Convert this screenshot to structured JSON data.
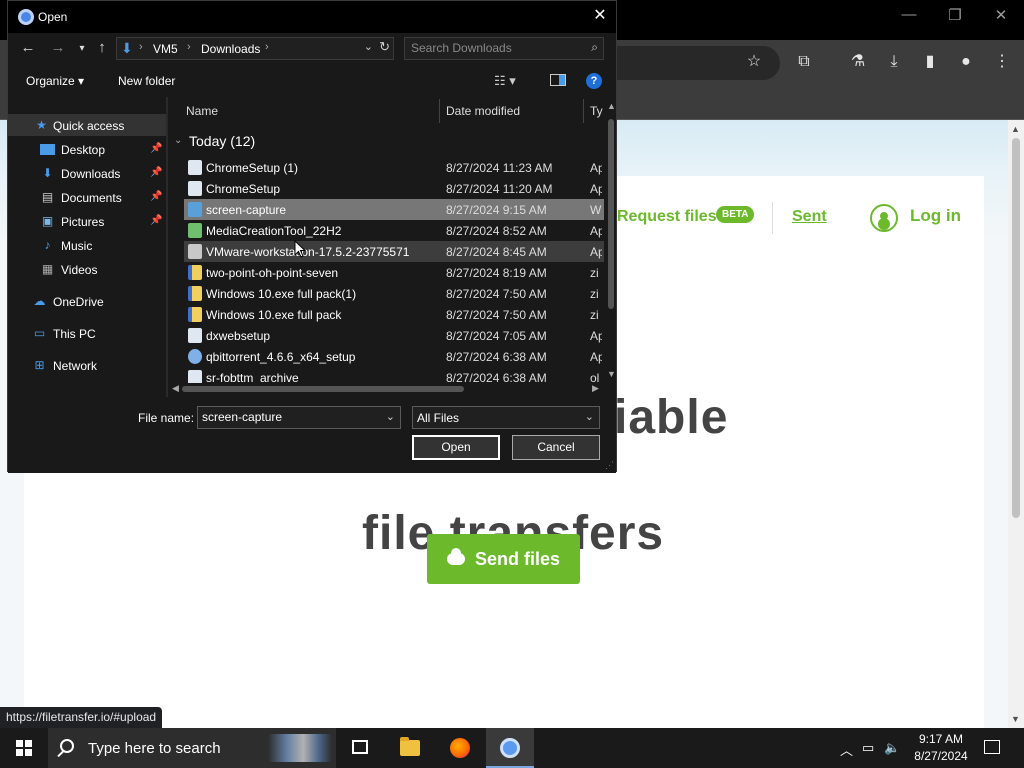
{
  "browser": {
    "nav": {
      "request_files": "Request files",
      "beta": "BETA",
      "sent": "Sent",
      "log_in": "Log in"
    },
    "hero": {
      "line1_visible": "iable",
      "line2_visible": "file transfers"
    },
    "send_button": "Send files",
    "status_url": "https://filetransfer.io/#upload"
  },
  "dialog": {
    "title": "Open",
    "breadcrumb": [
      "VM5",
      "Downloads"
    ],
    "search_placeholder": "Search Downloads",
    "toolbar": {
      "organize": "Organize ▾",
      "new_folder": "New folder",
      "help": "?"
    },
    "nav_pane": {
      "quick_access": "Quick access",
      "items": [
        {
          "label": "Desktop",
          "icon": "desktop-icon",
          "pinned": true
        },
        {
          "label": "Downloads",
          "icon": "downloads-icon",
          "pinned": true
        },
        {
          "label": "Documents",
          "icon": "documents-icon",
          "pinned": true
        },
        {
          "label": "Pictures",
          "icon": "pictures-icon",
          "pinned": true
        },
        {
          "label": "Music",
          "icon": "music-icon",
          "pinned": false
        },
        {
          "label": "Videos",
          "icon": "videos-icon",
          "pinned": false
        }
      ],
      "onedrive": "OneDrive",
      "this_pc": "This PC",
      "network": "Network"
    },
    "columns": {
      "name": "Name",
      "date_modified": "Date modified",
      "type": "Ty"
    },
    "group_header": "Today (12)",
    "files": [
      {
        "name": "ChromeSetup (1)",
        "date": "8/27/2024 11:23 AM",
        "type": "Ap",
        "icon": "installer-icon"
      },
      {
        "name": "ChromeSetup",
        "date": "8/27/2024 11:20 AM",
        "type": "Ap",
        "icon": "installer-icon"
      },
      {
        "name": "screen-capture",
        "date": "8/27/2024 9:15 AM",
        "type": "W",
        "icon": "image-file-icon"
      },
      {
        "name": "MediaCreationTool_22H2",
        "date": "8/27/2024 8:52 AM",
        "type": "Ap",
        "icon": "installer-icon"
      },
      {
        "name": "VMware-workstation-17.5.2-23775571",
        "date": "8/27/2024 8:45 AM",
        "type": "Ap",
        "icon": "installer-icon"
      },
      {
        "name": "two-point-oh-point-seven",
        "date": "8/27/2024 8:19 AM",
        "type": "zi",
        "icon": "zip-icon"
      },
      {
        "name": "Windows 10.exe full pack(1)",
        "date": "8/27/2024 7:50 AM",
        "type": "zi",
        "icon": "zip-icon"
      },
      {
        "name": "Windows 10.exe full pack",
        "date": "8/27/2024 7:50 AM",
        "type": "zi",
        "icon": "zip-icon"
      },
      {
        "name": "dxwebsetup",
        "date": "8/27/2024 7:05 AM",
        "type": "Ap",
        "icon": "installer-icon"
      },
      {
        "name": "qbittorrent_4.6.6_x64_setup",
        "date": "8/27/2024 6:38 AM",
        "type": "Ap",
        "icon": "installer-icon"
      },
      {
        "name": "sr-fobttm_archive",
        "date": "8/27/2024 6:38 AM",
        "type": "ol",
        "icon": "archive-icon"
      }
    ],
    "file_name_label": "File name:",
    "file_name_value": "screen-capture",
    "file_type_value": "All Files",
    "open_button": "Open",
    "cancel_button": "Cancel"
  },
  "taskbar": {
    "search_text": "Type here to search",
    "time": "9:17 AM",
    "date": "8/27/2024"
  },
  "colors": {
    "accent_green": "#6cba2b",
    "dialog_bg": "#191919",
    "selection": "#777777"
  }
}
